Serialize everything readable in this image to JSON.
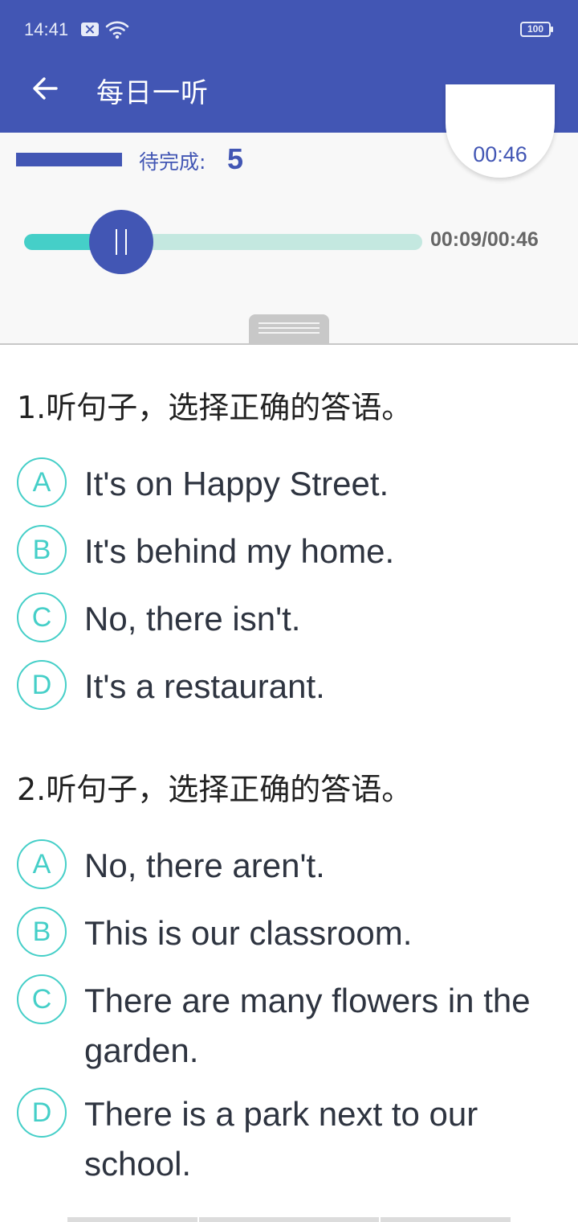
{
  "status_bar": {
    "time": "14:41",
    "battery": "100",
    "icons": [
      "sim-error-icon",
      "wifi-icon",
      "battery-icon"
    ]
  },
  "app_bar": {
    "title": "每日一听",
    "back_icon": "arrow-back-icon"
  },
  "player": {
    "pending_label": "待完成:",
    "pending_count": "5",
    "timer": "00:46",
    "time_readout": "00:09/00:46",
    "progress_fraction": 0.196,
    "pause_icon": "pause-icon"
  },
  "colors": {
    "primary": "#4256b4",
    "accent": "#45cfc8",
    "track": "#c4e8e0"
  },
  "questions": [
    {
      "title": "1.听句子，选择正确的答语。",
      "options": [
        {
          "letter": "A",
          "text": "It's on Happy Street."
        },
        {
          "letter": "B",
          "text": "It's behind my home."
        },
        {
          "letter": "C",
          "text": "No, there isn't."
        },
        {
          "letter": "D",
          "text": "It's a restaurant."
        }
      ]
    },
    {
      "title": "2.听句子，选择正确的答语。",
      "options": [
        {
          "letter": "A",
          "text": "No, there aren't."
        },
        {
          "letter": "B",
          "text": "This is our classroom."
        },
        {
          "letter": "C",
          "text": "There are many flowers in the garden."
        },
        {
          "letter": "D",
          "text": "There is a park next to our school."
        }
      ]
    }
  ]
}
